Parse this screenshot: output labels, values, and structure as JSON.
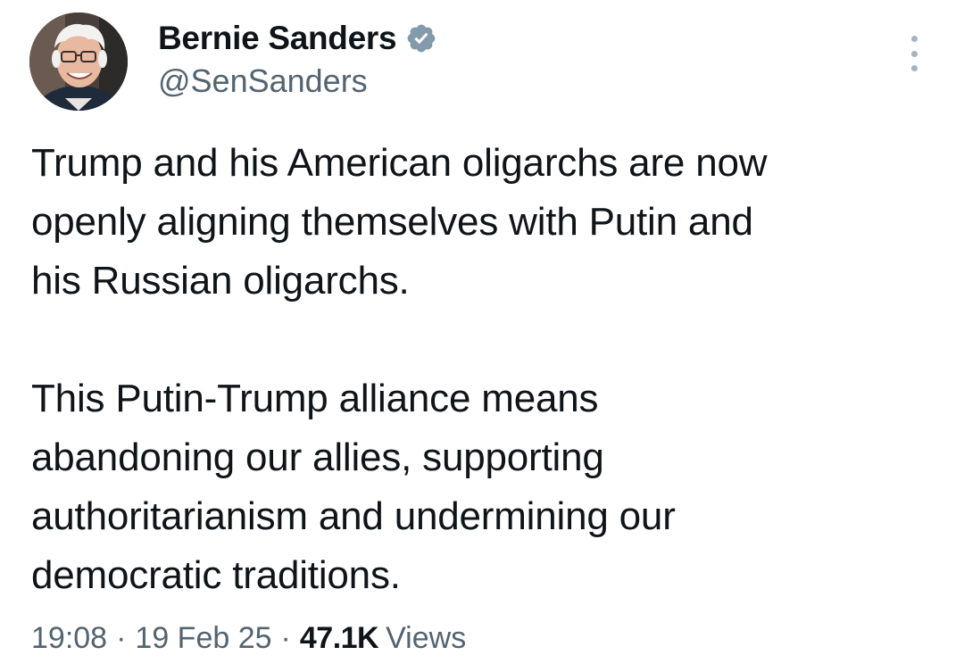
{
  "author": {
    "display_name": "Bernie Sanders",
    "handle": "@SenSanders",
    "verified": true,
    "verified_color": "#829aab"
  },
  "tweet": {
    "paragraph1": [
      "Trump and his American oligarchs are now",
      "openly aligning themselves with Putin and",
      "his Russian oligarchs."
    ],
    "paragraph2": [
      "This Putin-Trump alliance means",
      "abandoning our allies, supporting",
      "authoritarianism and undermining our",
      "democratic traditions."
    ]
  },
  "meta": {
    "time": "19:08",
    "separator": "·",
    "date": "19 Feb 25",
    "views_count": "47.1K",
    "views_label": "Views"
  },
  "icons": {
    "verified": "verified-badge-icon",
    "more": "more-options-icon"
  }
}
